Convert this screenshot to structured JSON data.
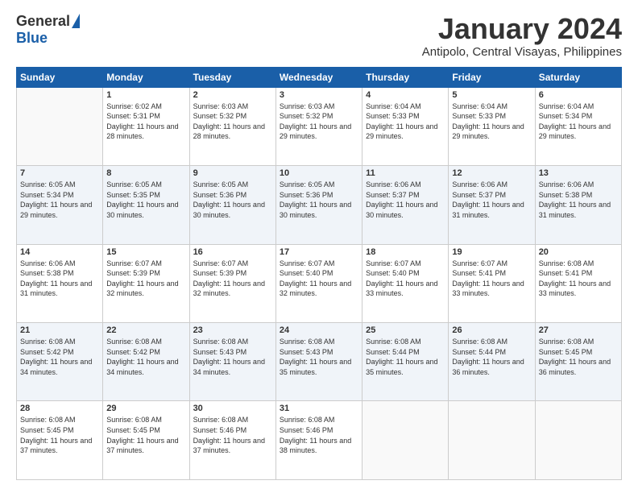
{
  "logo": {
    "general": "General",
    "blue": "Blue"
  },
  "header": {
    "month_title": "January 2024",
    "location": "Antipolo, Central Visayas, Philippines"
  },
  "days_of_week": [
    "Sunday",
    "Monday",
    "Tuesday",
    "Wednesday",
    "Thursday",
    "Friday",
    "Saturday"
  ],
  "weeks": [
    [
      {
        "day": "",
        "sunrise": "",
        "sunset": "",
        "daylight": ""
      },
      {
        "day": "1",
        "sunrise": "Sunrise: 6:02 AM",
        "sunset": "Sunset: 5:31 PM",
        "daylight": "Daylight: 11 hours and 28 minutes."
      },
      {
        "day": "2",
        "sunrise": "Sunrise: 6:03 AM",
        "sunset": "Sunset: 5:32 PM",
        "daylight": "Daylight: 11 hours and 28 minutes."
      },
      {
        "day": "3",
        "sunrise": "Sunrise: 6:03 AM",
        "sunset": "Sunset: 5:32 PM",
        "daylight": "Daylight: 11 hours and 29 minutes."
      },
      {
        "day": "4",
        "sunrise": "Sunrise: 6:04 AM",
        "sunset": "Sunset: 5:33 PM",
        "daylight": "Daylight: 11 hours and 29 minutes."
      },
      {
        "day": "5",
        "sunrise": "Sunrise: 6:04 AM",
        "sunset": "Sunset: 5:33 PM",
        "daylight": "Daylight: 11 hours and 29 minutes."
      },
      {
        "day": "6",
        "sunrise": "Sunrise: 6:04 AM",
        "sunset": "Sunset: 5:34 PM",
        "daylight": "Daylight: 11 hours and 29 minutes."
      }
    ],
    [
      {
        "day": "7",
        "sunrise": "Sunrise: 6:05 AM",
        "sunset": "Sunset: 5:34 PM",
        "daylight": "Daylight: 11 hours and 29 minutes."
      },
      {
        "day": "8",
        "sunrise": "Sunrise: 6:05 AM",
        "sunset": "Sunset: 5:35 PM",
        "daylight": "Daylight: 11 hours and 30 minutes."
      },
      {
        "day": "9",
        "sunrise": "Sunrise: 6:05 AM",
        "sunset": "Sunset: 5:36 PM",
        "daylight": "Daylight: 11 hours and 30 minutes."
      },
      {
        "day": "10",
        "sunrise": "Sunrise: 6:05 AM",
        "sunset": "Sunset: 5:36 PM",
        "daylight": "Daylight: 11 hours and 30 minutes."
      },
      {
        "day": "11",
        "sunrise": "Sunrise: 6:06 AM",
        "sunset": "Sunset: 5:37 PM",
        "daylight": "Daylight: 11 hours and 30 minutes."
      },
      {
        "day": "12",
        "sunrise": "Sunrise: 6:06 AM",
        "sunset": "Sunset: 5:37 PM",
        "daylight": "Daylight: 11 hours and 31 minutes."
      },
      {
        "day": "13",
        "sunrise": "Sunrise: 6:06 AM",
        "sunset": "Sunset: 5:38 PM",
        "daylight": "Daylight: 11 hours and 31 minutes."
      }
    ],
    [
      {
        "day": "14",
        "sunrise": "Sunrise: 6:06 AM",
        "sunset": "Sunset: 5:38 PM",
        "daylight": "Daylight: 11 hours and 31 minutes."
      },
      {
        "day": "15",
        "sunrise": "Sunrise: 6:07 AM",
        "sunset": "Sunset: 5:39 PM",
        "daylight": "Daylight: 11 hours and 32 minutes."
      },
      {
        "day": "16",
        "sunrise": "Sunrise: 6:07 AM",
        "sunset": "Sunset: 5:39 PM",
        "daylight": "Daylight: 11 hours and 32 minutes."
      },
      {
        "day": "17",
        "sunrise": "Sunrise: 6:07 AM",
        "sunset": "Sunset: 5:40 PM",
        "daylight": "Daylight: 11 hours and 32 minutes."
      },
      {
        "day": "18",
        "sunrise": "Sunrise: 6:07 AM",
        "sunset": "Sunset: 5:40 PM",
        "daylight": "Daylight: 11 hours and 33 minutes."
      },
      {
        "day": "19",
        "sunrise": "Sunrise: 6:07 AM",
        "sunset": "Sunset: 5:41 PM",
        "daylight": "Daylight: 11 hours and 33 minutes."
      },
      {
        "day": "20",
        "sunrise": "Sunrise: 6:08 AM",
        "sunset": "Sunset: 5:41 PM",
        "daylight": "Daylight: 11 hours and 33 minutes."
      }
    ],
    [
      {
        "day": "21",
        "sunrise": "Sunrise: 6:08 AM",
        "sunset": "Sunset: 5:42 PM",
        "daylight": "Daylight: 11 hours and 34 minutes."
      },
      {
        "day": "22",
        "sunrise": "Sunrise: 6:08 AM",
        "sunset": "Sunset: 5:42 PM",
        "daylight": "Daylight: 11 hours and 34 minutes."
      },
      {
        "day": "23",
        "sunrise": "Sunrise: 6:08 AM",
        "sunset": "Sunset: 5:43 PM",
        "daylight": "Daylight: 11 hours and 34 minutes."
      },
      {
        "day": "24",
        "sunrise": "Sunrise: 6:08 AM",
        "sunset": "Sunset: 5:43 PM",
        "daylight": "Daylight: 11 hours and 35 minutes."
      },
      {
        "day": "25",
        "sunrise": "Sunrise: 6:08 AM",
        "sunset": "Sunset: 5:44 PM",
        "daylight": "Daylight: 11 hours and 35 minutes."
      },
      {
        "day": "26",
        "sunrise": "Sunrise: 6:08 AM",
        "sunset": "Sunset: 5:44 PM",
        "daylight": "Daylight: 11 hours and 36 minutes."
      },
      {
        "day": "27",
        "sunrise": "Sunrise: 6:08 AM",
        "sunset": "Sunset: 5:45 PM",
        "daylight": "Daylight: 11 hours and 36 minutes."
      }
    ],
    [
      {
        "day": "28",
        "sunrise": "Sunrise: 6:08 AM",
        "sunset": "Sunset: 5:45 PM",
        "daylight": "Daylight: 11 hours and 37 minutes."
      },
      {
        "day": "29",
        "sunrise": "Sunrise: 6:08 AM",
        "sunset": "Sunset: 5:45 PM",
        "daylight": "Daylight: 11 hours and 37 minutes."
      },
      {
        "day": "30",
        "sunrise": "Sunrise: 6:08 AM",
        "sunset": "Sunset: 5:46 PM",
        "daylight": "Daylight: 11 hours and 37 minutes."
      },
      {
        "day": "31",
        "sunrise": "Sunrise: 6:08 AM",
        "sunset": "Sunset: 5:46 PM",
        "daylight": "Daylight: 11 hours and 38 minutes."
      },
      {
        "day": "",
        "sunrise": "",
        "sunset": "",
        "daylight": ""
      },
      {
        "day": "",
        "sunrise": "",
        "sunset": "",
        "daylight": ""
      },
      {
        "day": "",
        "sunrise": "",
        "sunset": "",
        "daylight": ""
      }
    ]
  ]
}
